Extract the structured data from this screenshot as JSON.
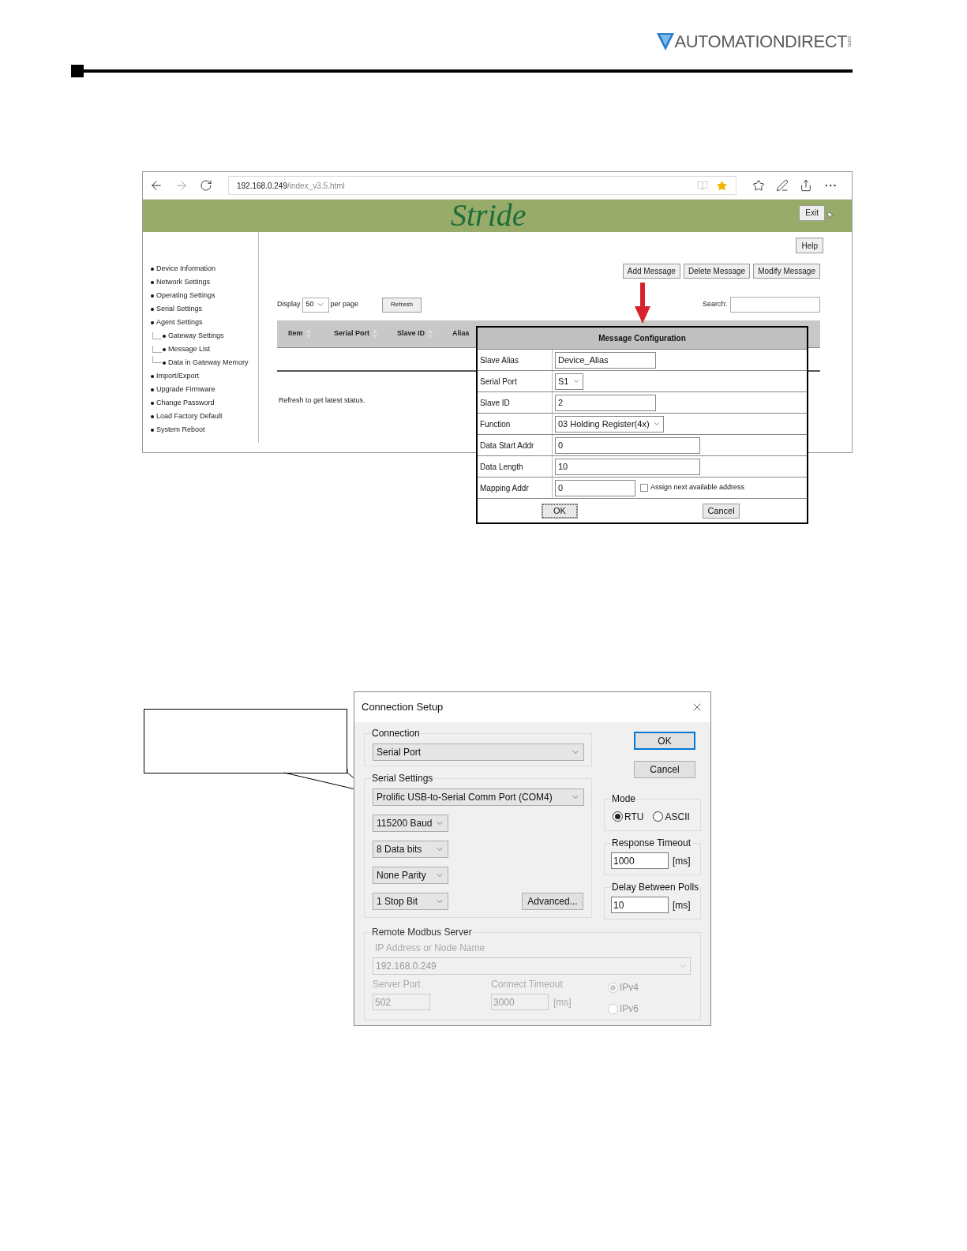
{
  "header": {
    "logo": "AUTOMATIONDIRECT",
    "logo_suffix": ".com"
  },
  "browser": {
    "address_host": "192.168.0.249",
    "address_path": "/index_v3.5.html",
    "site_logo": "Stride",
    "exit": "Exit",
    "help": "Help",
    "sidebar": [
      {
        "label": "Device Information"
      },
      {
        "label": "Network Settings"
      },
      {
        "label": "Operating Settings"
      },
      {
        "label": "Serial Settings"
      },
      {
        "label": "Agent Settings",
        "children": [
          {
            "label": "Gateway Settings"
          },
          {
            "label": "Message List"
          },
          {
            "label": "Data in Gateway Memory"
          }
        ]
      },
      {
        "label": "Import/Export"
      },
      {
        "label": "Upgrade Firmware"
      },
      {
        "label": "Change Password"
      },
      {
        "label": "Load Factory Default"
      },
      {
        "label": "System Reboot"
      }
    ],
    "actions": [
      "Add Message",
      "Delete Message",
      "Modify Message"
    ],
    "display_label": "Display",
    "display_value": "50",
    "per_page": "per page",
    "refresh": "Refresh",
    "search_label": "Search:",
    "columns": [
      {
        "label": "Item",
        "sortable": true
      },
      {
        "label": "Serial Port",
        "sortable": true
      },
      {
        "label": "Slave ID",
        "sortable": true
      },
      {
        "label": "Alias",
        "sortable": false
      }
    ],
    "status": "Refresh to get latest status."
  },
  "message_config": {
    "title": "Message Configuration",
    "rows": [
      {
        "label": "Slave Alias",
        "kind": "text",
        "value": "Device_Alias"
      },
      {
        "label": "Serial Port",
        "kind": "select",
        "value": "S1"
      },
      {
        "label": "Slave ID",
        "kind": "text",
        "value": "2"
      },
      {
        "label": "Function",
        "kind": "select",
        "value": "03 Holding Register(4x)"
      },
      {
        "label": "Data Start Addr",
        "kind": "text",
        "value": "0"
      },
      {
        "label": "Data Length",
        "kind": "text",
        "value": "10"
      },
      {
        "label": "Mapping Addr",
        "kind": "text",
        "value": "0",
        "checkbox": {
          "label": "Assign next available address",
          "checked": false
        }
      }
    ],
    "buttons": [
      "OK",
      "Cancel"
    ]
  },
  "connection_setup": {
    "title": "Connection Setup",
    "connection": {
      "label": "Connection",
      "value": "Serial Port"
    },
    "serial": {
      "label": "Serial Settings",
      "port": "Prolific USB-to-Serial Comm Port (COM4)",
      "selects": [
        "115200 Baud",
        "8 Data bits",
        "None Parity",
        "1 Stop Bit"
      ],
      "advanced": "Advanced..."
    },
    "buttons": [
      "OK",
      "Cancel"
    ],
    "mode": {
      "label": "Mode",
      "options": [
        {
          "label": "RTU",
          "selected": true
        },
        {
          "label": "ASCII",
          "selected": false
        }
      ]
    },
    "response_timeout": {
      "label": "Response Timeout",
      "value": "1000",
      "unit": "[ms]"
    },
    "delay": {
      "label": "Delay Between Polls",
      "value": "10",
      "unit": "[ms]"
    },
    "remote": {
      "label": "Remote Modbus Server",
      "disabled": true,
      "ip_label": "IP Address or Node Name",
      "ip_value": "192.168.0.249",
      "port_label": "Server Port",
      "port_value": "502",
      "timeout_label": "Connect Timeout",
      "timeout_value": "3000",
      "timeout_unit": "[ms]",
      "ip_versions": [
        {
          "label": "IPv4",
          "selected": true
        },
        {
          "label": "IPv6",
          "selected": false
        }
      ]
    }
  }
}
